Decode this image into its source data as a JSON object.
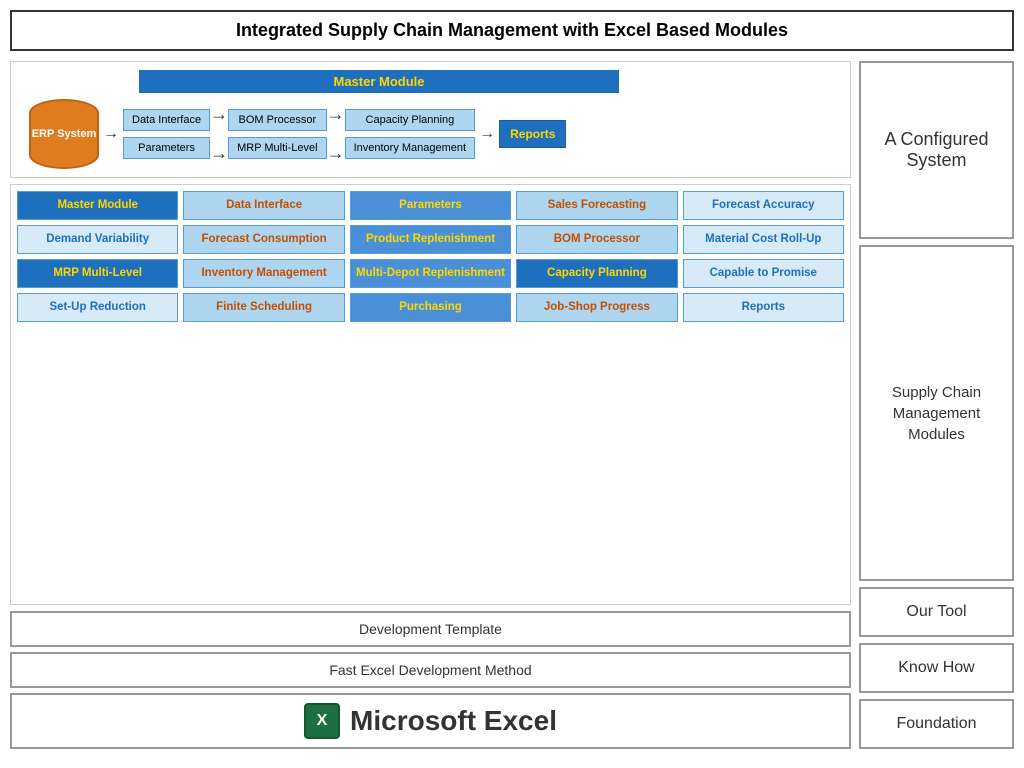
{
  "title": "Integrated Supply Chain Management with Excel Based Modules",
  "diagram": {
    "master_module": "Master Module",
    "erp_label": "ERP System",
    "boxes": {
      "data_interface": "Data Interface",
      "parameters": "Parameters",
      "bom_processor": "BOM Processor",
      "mrp": "MRP Multi-Level",
      "capacity_planning": "Capacity Planning",
      "inventory_mgmt": "Inventory Management",
      "reports": "Reports"
    }
  },
  "modules": [
    {
      "label": "Master Module",
      "style": "dark"
    },
    {
      "label": "Data Interface",
      "style": "light-text"
    },
    {
      "label": "Parameters",
      "style": "medium"
    },
    {
      "label": "Sales Forecasting",
      "style": "light-text"
    },
    {
      "label": "Forecast Accuracy",
      "style": "very-light"
    },
    {
      "label": "Demand Variability",
      "style": "very-light"
    },
    {
      "label": "Forecast Consumption",
      "style": "light-text"
    },
    {
      "label": "Product Replenishment",
      "style": "medium"
    },
    {
      "label": "BOM Processor",
      "style": "light-text"
    },
    {
      "label": "Material Cost Roll-Up",
      "style": "very-light"
    },
    {
      "label": "MRP Multi-Level",
      "style": "dark"
    },
    {
      "label": "Inventory Management",
      "style": "light-text"
    },
    {
      "label": "Multi-Depot Replenishment",
      "style": "medium"
    },
    {
      "label": "Capacity Planning",
      "style": "dark"
    },
    {
      "label": "Capable to Promise",
      "style": "very-light"
    },
    {
      "label": "Set-Up Reduction",
      "style": "very-light"
    },
    {
      "label": "Finite Scheduling",
      "style": "light-text"
    },
    {
      "label": "Purchasing",
      "style": "medium"
    },
    {
      "label": "Job-Shop Progress",
      "style": "light-text"
    },
    {
      "label": "Reports",
      "style": "very-light"
    }
  ],
  "bottom": {
    "development_template": "Development Template",
    "fast_excel": "Fast Excel Development Method",
    "microsoft_excel": "Microsoft Excel",
    "excel_letter": "X"
  },
  "right_panel": {
    "configured_system": "A Configured System",
    "supply_chain_label": "Supply Chain Management Modules",
    "our_tool": "Our Tool",
    "know_how": "Know How",
    "foundation": "Foundation"
  }
}
